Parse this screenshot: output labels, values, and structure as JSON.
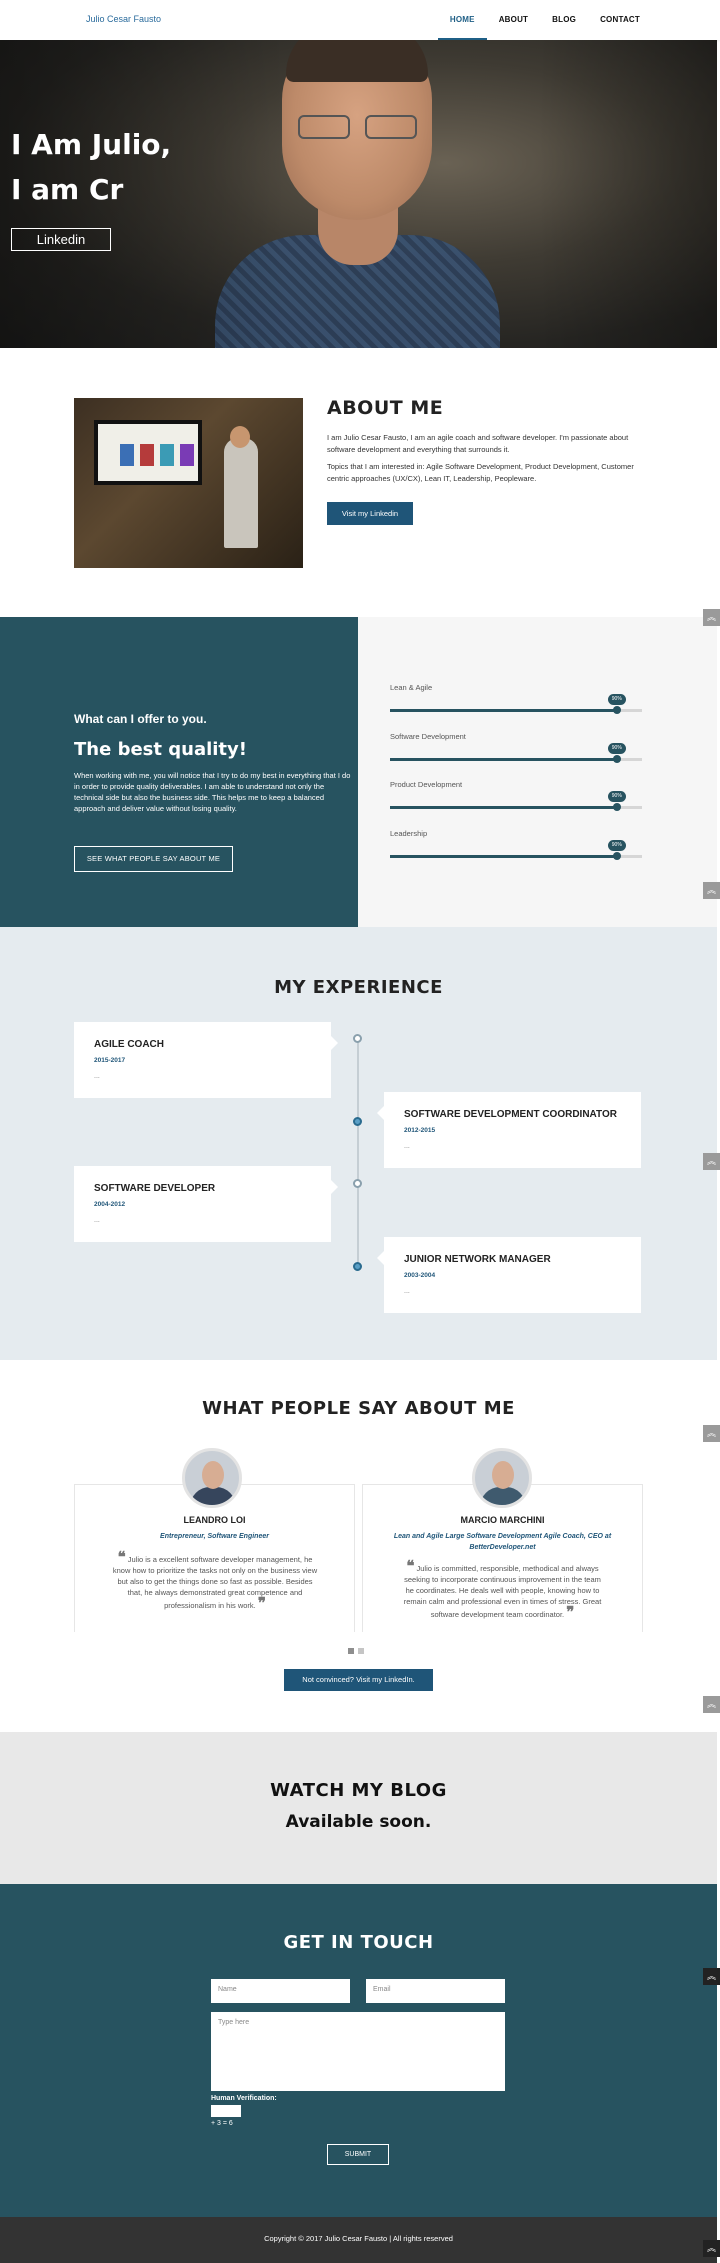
{
  "nav": {
    "brand": "Julio Cesar Fausto",
    "items": [
      {
        "label": "HOME",
        "active": true
      },
      {
        "label": "ABOUT",
        "active": false
      },
      {
        "label": "BLOG",
        "active": false
      },
      {
        "label": "CONTACT",
        "active": false
      }
    ]
  },
  "hero": {
    "line1": "I Am Julio,",
    "line2": "I am Cr",
    "button": "Linkedin"
  },
  "about": {
    "title": "ABOUT ME",
    "p1": "I am Julio Cesar Fausto, I am an agile coach and software developer. I'm passionate about software development and everything that surrounds it.",
    "p2": "Topics that I am interested in: Agile Software Development, Product Development, Customer centric approaches (UX/CX), Lean IT, Leadership, Peopleware.",
    "button": "Visit my Linkedin"
  },
  "offer": {
    "title": "What can I offer to you.",
    "subtitle": "The best quality!",
    "text": "When working with me, you will notice that I try to do my best in everything that I do in order to provide quality deliverables. I am able to understand not only the technical side but also the business side. This helps me to keep a balanced approach and deliver value without losing quality.",
    "button": "SEE WHAT PEOPLE SAY ABOUT ME",
    "skills": [
      {
        "label": "Lean & Agile",
        "percent": 90,
        "badge": "90%"
      },
      {
        "label": "Software Development",
        "percent": 90,
        "badge": "90%"
      },
      {
        "label": "Product Development",
        "percent": 90,
        "badge": "90%"
      },
      {
        "label": "Leadership",
        "percent": 90,
        "badge": "90%"
      }
    ]
  },
  "experience": {
    "title": "MY EXPERIENCE",
    "items": [
      {
        "role": "AGILE COACH",
        "dates": "2015-2017",
        "desc": "..."
      },
      {
        "role": "SOFTWARE DEVELOPMENT COORDINATOR",
        "dates": "2012-2015",
        "desc": "..."
      },
      {
        "role": "SOFTWARE DEVELOPER",
        "dates": "2004-2012",
        "desc": "..."
      },
      {
        "role": "JUNIOR NETWORK MANAGER",
        "dates": "2003-2004",
        "desc": "..."
      }
    ]
  },
  "testimonials": {
    "title": "WHAT PEOPLE SAY ABOUT ME",
    "items": [
      {
        "name": "LEANDRO LOI",
        "role": "Entrepreneur, Software Engineer",
        "quote": "Julio is a excellent software developer management, he know how to prioritize the tasks not only on the business view but also to get the things done so fast as possible. Besides that, he always demonstrated great competence and professionalism in his work."
      },
      {
        "name": "MARCIO MARCHINI",
        "role": "Lean and Agile Large Software Development Agile Coach, CEO at BetterDeveloper.net",
        "quote": "Julio is committed, responsible, methodical and always seeking to incorporate continuous improvement in the team he coordinates. He deals well with people, knowing how to remain calm and professional even in times of stress. Great software development team coordinator."
      }
    ],
    "button": "Not convinced? Visit my LinkedIn."
  },
  "blog": {
    "title": "WATCH MY BLOG",
    "subtitle": "Available soon."
  },
  "contact": {
    "title": "GET IN TOUCH",
    "name_placeholder": "Name",
    "email_placeholder": "Email",
    "message_placeholder": "Type here",
    "verification_label": "Human Verification:",
    "verification_equation": "+ 3 = 6",
    "submit": "SUBMIT"
  },
  "footer": {
    "text": "Copyright © 2017 Julio Cesar Fausto | All rights reserved"
  },
  "colors": {
    "accent": "#1f5578",
    "teal": "#275360",
    "nav_active": "#1f5f86"
  },
  "icons": {
    "scroll_top": "chevron-double-up-icon"
  }
}
